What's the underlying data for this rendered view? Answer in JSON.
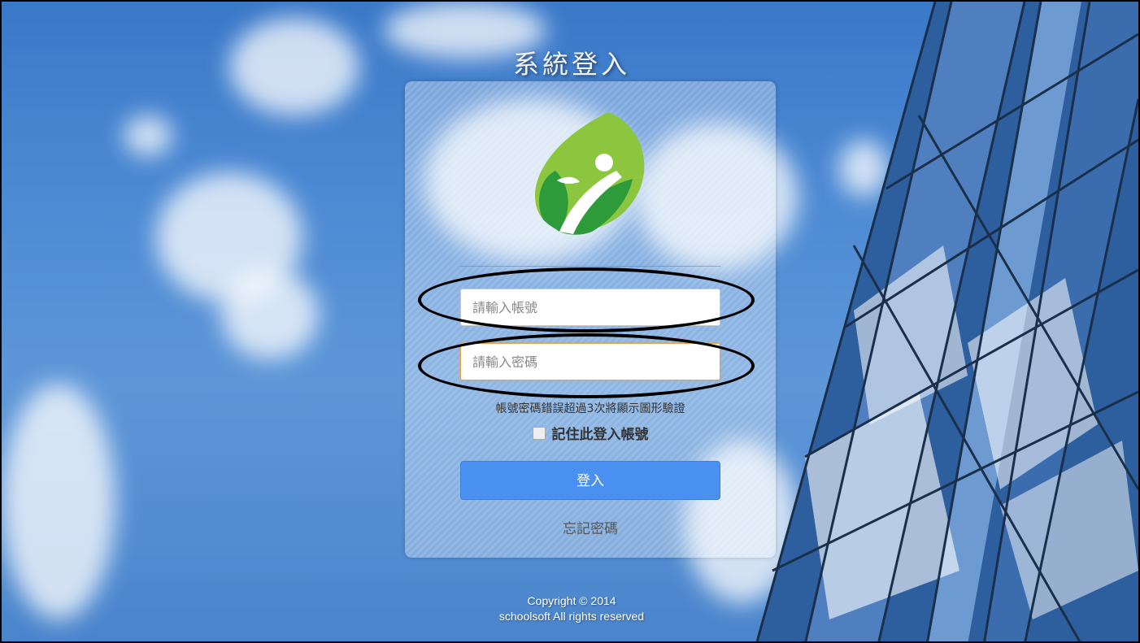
{
  "page": {
    "title": "系統登入"
  },
  "login_form": {
    "account_placeholder": "請輸入帳號",
    "password_placeholder": "請輸入密碼",
    "hint": "帳號密碼錯誤超過3次將顯示圖形驗證",
    "remember_label": "記住此登入帳號",
    "remember_checked": false,
    "login_button": "登入",
    "forgot_link": "忘記密碼"
  },
  "footer": {
    "copyright_line1": "Copyright © 2014",
    "copyright_line2": "schoolsoft All rights reserved"
  },
  "colors": {
    "login_button": "#4a90f0",
    "focus_border": "#e8a33a",
    "logo_green_light": "#8cc63f",
    "logo_green_dark": "#2e9b3a"
  },
  "icons": {
    "logo": "leaf-person-logo"
  }
}
